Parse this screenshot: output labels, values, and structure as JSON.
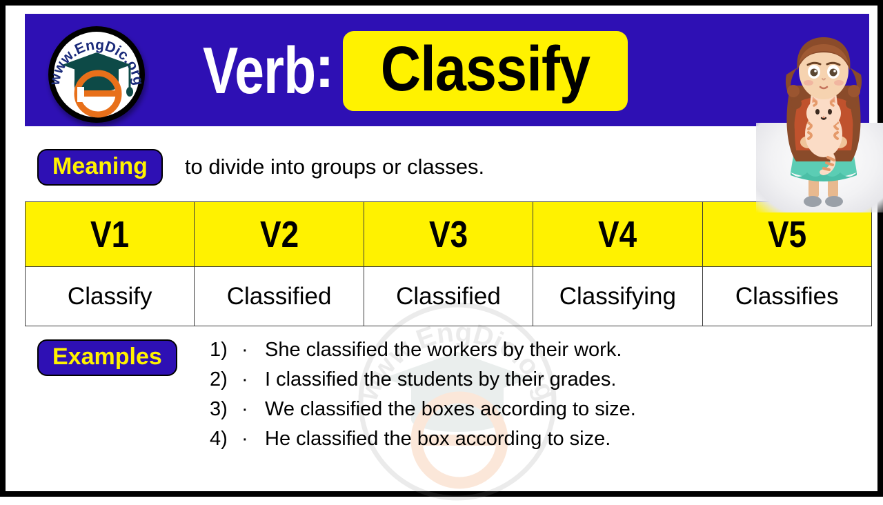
{
  "header": {
    "part_of_speech": "Verb",
    "separator": ":",
    "word": "Classify",
    "logo_text": "www.EngDic.org",
    "colors": {
      "band_blue": "#2E10B4",
      "badge_yellow": "#FFF200",
      "word_text": "#000000",
      "pos_text": "#ffffff"
    }
  },
  "meaning": {
    "label": "Meaning",
    "text": "to divide into groups or classes."
  },
  "verb_table": {
    "headers": [
      "V1",
      "V2",
      "V3",
      "V4",
      "V5"
    ],
    "forms": [
      "Classify",
      "Classified",
      "Classified",
      "Classifying",
      "Classifies"
    ]
  },
  "examples": {
    "label": "Examples",
    "items": [
      {
        "number": "1)",
        "bullet": "·",
        "sentence": "She classified the workers by their work."
      },
      {
        "number": "2)",
        "bullet": "·",
        "sentence": "I classified the students by their grades."
      },
      {
        "number": "3)",
        "bullet": "·",
        "sentence": "We classified the boxes according to size."
      },
      {
        "number": "4)",
        "bullet": "·",
        "sentence": "He classified the box according to size."
      }
    ]
  },
  "watermark": {
    "text": "www.EngDic.org"
  },
  "illustration": {
    "description": "girl holding cat"
  }
}
